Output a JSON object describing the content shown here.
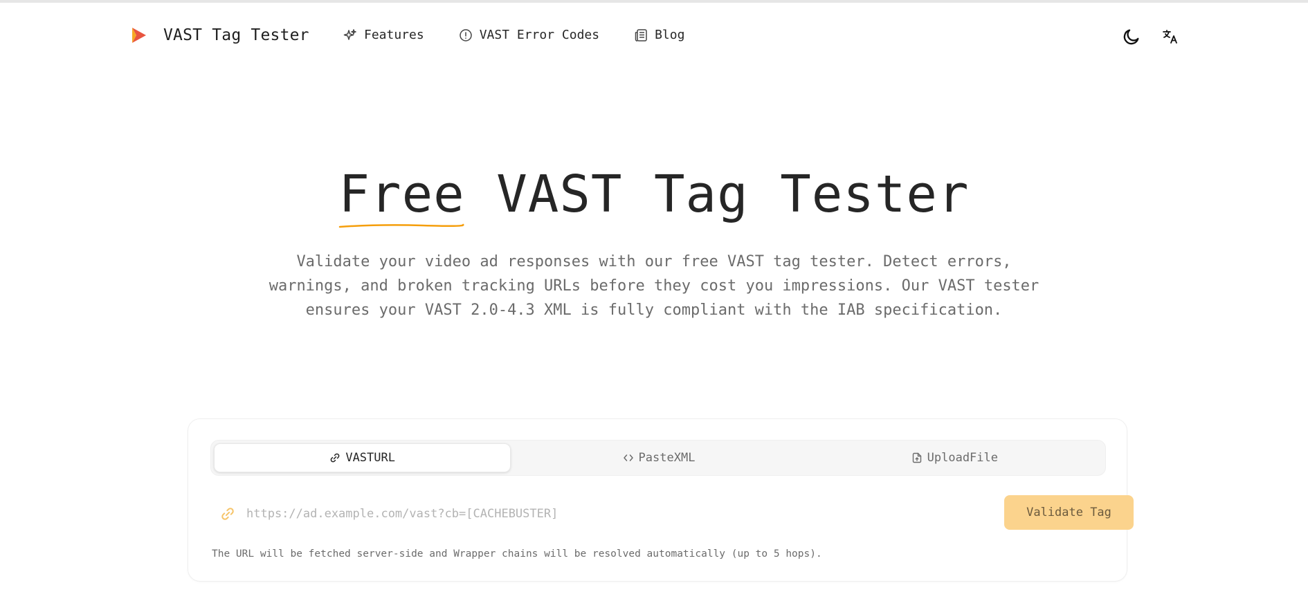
{
  "header": {
    "app_title": "VAST Tag Tester",
    "nav": [
      {
        "label": "Features",
        "icon": "sparkles-icon"
      },
      {
        "label": "VAST Error Codes",
        "icon": "alert-circle-icon"
      },
      {
        "label": "Blog",
        "icon": "newspaper-icon"
      }
    ],
    "actions": [
      "moon-icon",
      "translate-icon"
    ]
  },
  "hero": {
    "title_accent": "Free",
    "title_rest": " VAST Tag Tester",
    "subtitle": "Validate your video ad responses with our free VAST tag tester. Detect errors, warnings, and broken tracking URLs before they cost you impressions. Our VAST tester ensures your VAST 2.0-4.3 XML is fully compliant with the IAB specification."
  },
  "tester": {
    "tabs": [
      {
        "label": "VASTURL",
        "icon": "link-icon",
        "active": true
      },
      {
        "label": "PasteXML",
        "icon": "code-icon",
        "active": false
      },
      {
        "label": "UploadFile",
        "icon": "file-upload-icon",
        "active": false
      }
    ],
    "url_placeholder": "https://ad.example.com/vast?cb=[CACHEBUSTER]",
    "url_value": "",
    "validate_label": "Validate Tag",
    "hint": "The URL will be fetched server-side and Wrapper chains will be resolved automatically (up to 5 hops)."
  },
  "colors": {
    "brand": "#e8553f",
    "accent": "#f59e0b",
    "button": "#fbd38d"
  }
}
